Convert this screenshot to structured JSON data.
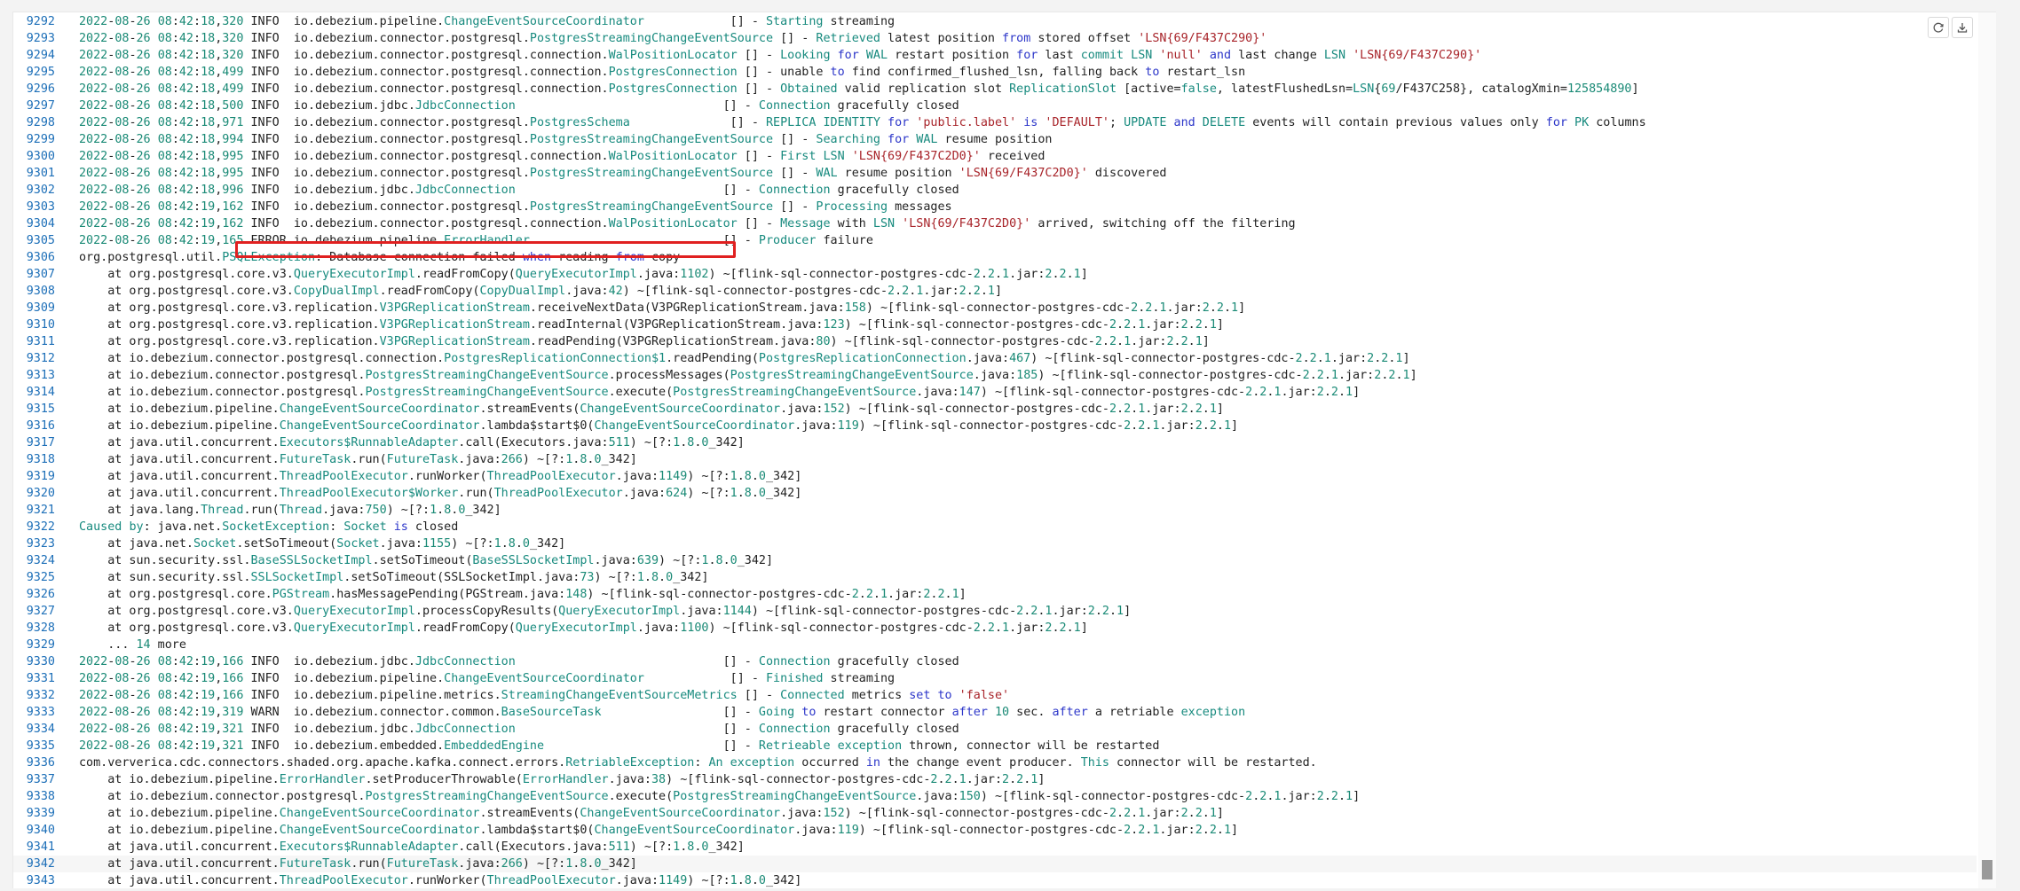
{
  "toolbar": {
    "refresh_icon": "refresh-icon",
    "download_icon": "download-icon"
  },
  "highlight": {
    "line_number": "9305"
  },
  "log": {
    "lines": [
      {
        "n": "9292",
        "t": "2022-08-26 08:42:18,320 INFO  io.debezium.pipeline.ChangeEventSourceCoordinator            [] - Starting streaming"
      },
      {
        "n": "9293",
        "t": "2022-08-26 08:42:18,320 INFO  io.debezium.connector.postgresql.PostgresStreamingChangeEventSource [] - Retrieved latest position from stored offset 'LSN{69/F437C290}'"
      },
      {
        "n": "9294",
        "t": "2022-08-26 08:42:18,320 INFO  io.debezium.connector.postgresql.connection.WalPositionLocator [] - Looking for WAL restart position for last commit LSN 'null' and last change LSN 'LSN{69/F437C290}'"
      },
      {
        "n": "9295",
        "t": "2022-08-26 08:42:18,499 INFO  io.debezium.connector.postgresql.connection.PostgresConnection [] - unable to find confirmed_flushed_lsn, falling back to restart_lsn"
      },
      {
        "n": "9296",
        "t": "2022-08-26 08:42:18,499 INFO  io.debezium.connector.postgresql.connection.PostgresConnection [] - Obtained valid replication slot ReplicationSlot [active=false, latestFlushedLsn=LSN{69/F437C258}, catalogXmin=125854890]"
      },
      {
        "n": "9297",
        "t": "2022-08-26 08:42:18,500 INFO  io.debezium.jdbc.JdbcConnection                             [] - Connection gracefully closed"
      },
      {
        "n": "9298",
        "t": "2022-08-26 08:42:18,971 INFO  io.debezium.connector.postgresql.PostgresSchema              [] - REPLICA IDENTITY for 'public.label' is 'DEFAULT'; UPDATE and DELETE events will contain previous values only for PK columns"
      },
      {
        "n": "9299",
        "t": "2022-08-26 08:42:18,994 INFO  io.debezium.connector.postgresql.PostgresStreamingChangeEventSource [] - Searching for WAL resume position"
      },
      {
        "n": "9300",
        "t": "2022-08-26 08:42:18,995 INFO  io.debezium.connector.postgresql.connection.WalPositionLocator [] - First LSN 'LSN{69/F437C2D0}' received"
      },
      {
        "n": "9301",
        "t": "2022-08-26 08:42:18,995 INFO  io.debezium.connector.postgresql.PostgresStreamingChangeEventSource [] - WAL resume position 'LSN{69/F437C2D0}' discovered"
      },
      {
        "n": "9302",
        "t": "2022-08-26 08:42:18,996 INFO  io.debezium.jdbc.JdbcConnection                             [] - Connection gracefully closed"
      },
      {
        "n": "9303",
        "t": "2022-08-26 08:42:19,162 INFO  io.debezium.connector.postgresql.PostgresStreamingChangeEventSource [] - Processing messages"
      },
      {
        "n": "9304",
        "t": "2022-08-26 08:42:19,162 INFO  io.debezium.connector.postgresql.connection.WalPositionLocator [] - Message with LSN 'LSN{69/F437C2D0}' arrived, switching off the filtering"
      },
      {
        "n": "9305",
        "t": "2022-08-26 08:42:19,165 ERROR io.debezium.pipeline.ErrorHandler                           [] - Producer failure"
      },
      {
        "n": "9306",
        "t": "org.postgresql.util.PSQLException: Database connection failed when reading from copy"
      },
      {
        "n": "9307",
        "t": "    at org.postgresql.core.v3.QueryExecutorImpl.readFromCopy(QueryExecutorImpl.java:1102) ~[flink-sql-connector-postgres-cdc-2.2.1.jar:2.2.1]"
      },
      {
        "n": "9308",
        "t": "    at org.postgresql.core.v3.CopyDualImpl.readFromCopy(CopyDualImpl.java:42) ~[flink-sql-connector-postgres-cdc-2.2.1.jar:2.2.1]"
      },
      {
        "n": "9309",
        "t": "    at org.postgresql.core.v3.replication.V3PGReplicationStream.receiveNextData(V3PGReplicationStream.java:158) ~[flink-sql-connector-postgres-cdc-2.2.1.jar:2.2.1]"
      },
      {
        "n": "9310",
        "t": "    at org.postgresql.core.v3.replication.V3PGReplicationStream.readInternal(V3PGReplicationStream.java:123) ~[flink-sql-connector-postgres-cdc-2.2.1.jar:2.2.1]"
      },
      {
        "n": "9311",
        "t": "    at org.postgresql.core.v3.replication.V3PGReplicationStream.readPending(V3PGReplicationStream.java:80) ~[flink-sql-connector-postgres-cdc-2.2.1.jar:2.2.1]"
      },
      {
        "n": "9312",
        "t": "    at io.debezium.connector.postgresql.connection.PostgresReplicationConnection$1.readPending(PostgresReplicationConnection.java:467) ~[flink-sql-connector-postgres-cdc-2.2.1.jar:2.2.1]"
      },
      {
        "n": "9313",
        "t": "    at io.debezium.connector.postgresql.PostgresStreamingChangeEventSource.processMessages(PostgresStreamingChangeEventSource.java:185) ~[flink-sql-connector-postgres-cdc-2.2.1.jar:2.2.1]"
      },
      {
        "n": "9314",
        "t": "    at io.debezium.connector.postgresql.PostgresStreamingChangeEventSource.execute(PostgresStreamingChangeEventSource.java:147) ~[flink-sql-connector-postgres-cdc-2.2.1.jar:2.2.1]"
      },
      {
        "n": "9315",
        "t": "    at io.debezium.pipeline.ChangeEventSourceCoordinator.streamEvents(ChangeEventSourceCoordinator.java:152) ~[flink-sql-connector-postgres-cdc-2.2.1.jar:2.2.1]"
      },
      {
        "n": "9316",
        "t": "    at io.debezium.pipeline.ChangeEventSourceCoordinator.lambda$start$0(ChangeEventSourceCoordinator.java:119) ~[flink-sql-connector-postgres-cdc-2.2.1.jar:2.2.1]"
      },
      {
        "n": "9317",
        "t": "    at java.util.concurrent.Executors$RunnableAdapter.call(Executors.java:511) ~[?:1.8.0_342]"
      },
      {
        "n": "9318",
        "t": "    at java.util.concurrent.FutureTask.run(FutureTask.java:266) ~[?:1.8.0_342]"
      },
      {
        "n": "9319",
        "t": "    at java.util.concurrent.ThreadPoolExecutor.runWorker(ThreadPoolExecutor.java:1149) ~[?:1.8.0_342]"
      },
      {
        "n": "9320",
        "t": "    at java.util.concurrent.ThreadPoolExecutor$Worker.run(ThreadPoolExecutor.java:624) ~[?:1.8.0_342]"
      },
      {
        "n": "9321",
        "t": "    at java.lang.Thread.run(Thread.java:750) ~[?:1.8.0_342]"
      },
      {
        "n": "9322",
        "t": "Caused by: java.net.SocketException: Socket is closed"
      },
      {
        "n": "9323",
        "t": "    at java.net.Socket.setSoTimeout(Socket.java:1155) ~[?:1.8.0_342]"
      },
      {
        "n": "9324",
        "t": "    at sun.security.ssl.BaseSSLSocketImpl.setSoTimeout(BaseSSLSocketImpl.java:639) ~[?:1.8.0_342]"
      },
      {
        "n": "9325",
        "t": "    at sun.security.ssl.SSLSocketImpl.setSoTimeout(SSLSocketImpl.java:73) ~[?:1.8.0_342]"
      },
      {
        "n": "9326",
        "t": "    at org.postgresql.core.PGStream.hasMessagePending(PGStream.java:148) ~[flink-sql-connector-postgres-cdc-2.2.1.jar:2.2.1]"
      },
      {
        "n": "9327",
        "t": "    at org.postgresql.core.v3.QueryExecutorImpl.processCopyResults(QueryExecutorImpl.java:1144) ~[flink-sql-connector-postgres-cdc-2.2.1.jar:2.2.1]"
      },
      {
        "n": "9328",
        "t": "    at org.postgresql.core.v3.QueryExecutorImpl.readFromCopy(QueryExecutorImpl.java:1100) ~[flink-sql-connector-postgres-cdc-2.2.1.jar:2.2.1]"
      },
      {
        "n": "9329",
        "t": "    ... 14 more"
      },
      {
        "n": "9330",
        "t": "2022-08-26 08:42:19,166 INFO  io.debezium.jdbc.JdbcConnection                             [] - Connection gracefully closed"
      },
      {
        "n": "9331",
        "t": "2022-08-26 08:42:19,166 INFO  io.debezium.pipeline.ChangeEventSourceCoordinator            [] - Finished streaming"
      },
      {
        "n": "9332",
        "t": "2022-08-26 08:42:19,166 INFO  io.debezium.pipeline.metrics.StreamingChangeEventSourceMetrics [] - Connected metrics set to 'false'"
      },
      {
        "n": "9333",
        "t": "2022-08-26 08:42:19,319 WARN  io.debezium.connector.common.BaseSourceTask                 [] - Going to restart connector after 10 sec. after a retriable exception"
      },
      {
        "n": "9334",
        "t": "2022-08-26 08:42:19,321 INFO  io.debezium.jdbc.JdbcConnection                             [] - Connection gracefully closed"
      },
      {
        "n": "9335",
        "t": "2022-08-26 08:42:19,321 INFO  io.debezium.embedded.EmbeddedEngine                         [] - Retrieable exception thrown, connector will be restarted"
      },
      {
        "n": "9336",
        "t": "com.ververica.cdc.connectors.shaded.org.apache.kafka.connect.errors.RetriableException: An exception occurred in the change event producer. This connector will be restarted."
      },
      {
        "n": "9337",
        "t": "    at io.debezium.pipeline.ErrorHandler.setProducerThrowable(ErrorHandler.java:38) ~[flink-sql-connector-postgres-cdc-2.2.1.jar:2.2.1]"
      },
      {
        "n": "9338",
        "t": "    at io.debezium.connector.postgresql.PostgresStreamingChangeEventSource.execute(PostgresStreamingChangeEventSource.java:150) ~[flink-sql-connector-postgres-cdc-2.2.1.jar:2.2.1]"
      },
      {
        "n": "9339",
        "t": "    at io.debezium.pipeline.ChangeEventSourceCoordinator.streamEvents(ChangeEventSourceCoordinator.java:152) ~[flink-sql-connector-postgres-cdc-2.2.1.jar:2.2.1]"
      },
      {
        "n": "9340",
        "t": "    at io.debezium.pipeline.ChangeEventSourceCoordinator.lambda$start$0(ChangeEventSourceCoordinator.java:119) ~[flink-sql-connector-postgres-cdc-2.2.1.jar:2.2.1]"
      },
      {
        "n": "9341",
        "t": "    at java.util.concurrent.Executors$RunnableAdapter.call(Executors.java:511) ~[?:1.8.0_342]"
      },
      {
        "n": "9342",
        "t": "    at java.util.concurrent.FutureTask.run(FutureTask.java:266) ~[?:1.8.0_342]"
      },
      {
        "n": "9343",
        "t": "    at java.util.concurrent.ThreadPoolExecutor.runWorker(ThreadPoolExecutor.java:1149) ~[?:1.8.0_342]"
      }
    ]
  },
  "cursor_line": "9342"
}
